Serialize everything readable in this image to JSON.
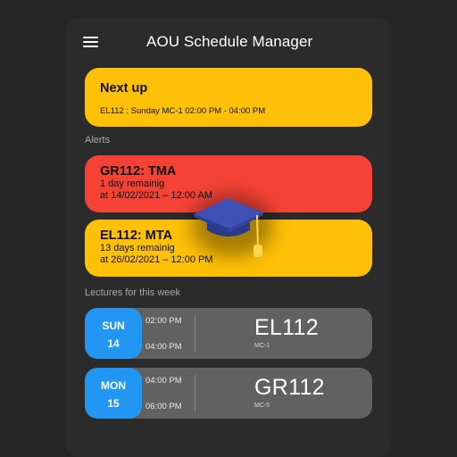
{
  "app": {
    "title": "AOU Schedule Manager"
  },
  "icons": {
    "menu": "hamburger-menu-icon",
    "logo": "graduation-cap-icon"
  },
  "colors": {
    "background": "#2b2b2b",
    "next_up_card": "#ffc107",
    "alert_urgent": "#f44336",
    "alert_normal": "#ffc107",
    "lecture_day": "#2196f3",
    "lecture_card": "#616161",
    "cap": "#3f51b5",
    "tassel": "#ffd54f"
  },
  "next_up": {
    "title": "Next up",
    "detail": "EL112 : Sunday MC-1 02:00 PM - 04:00 PM"
  },
  "alerts_section": {
    "label": "Alerts",
    "items": [
      {
        "title": "GR112: TMA",
        "remaining": "1 day remainig",
        "due": "at 14/02/2021 – 12:00 AM"
      },
      {
        "title": "EL112: MTA",
        "remaining": "13 days remainig",
        "due": "at 26/02/2021 – 12:00 PM"
      }
    ]
  },
  "lectures_section": {
    "label": "Lectures for this week",
    "items": [
      {
        "day": "SUN",
        "date": "14",
        "start": "02:00 PM",
        "end": "04:00 PM",
        "course": "EL112",
        "room": "MC-1"
      },
      {
        "day": "MON",
        "date": "15",
        "start": "04:00 PM",
        "end": "06:00 PM",
        "course": "GR112",
        "room": "MC-5"
      }
    ]
  }
}
